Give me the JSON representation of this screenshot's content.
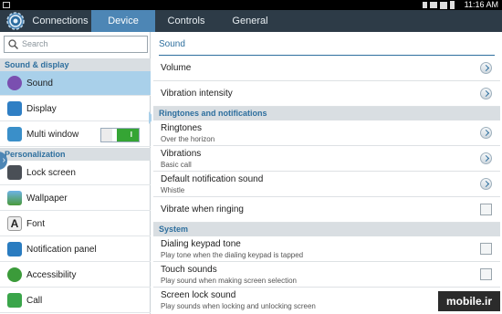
{
  "status_bar": {
    "time": "11:16 AM"
  },
  "tabs": [
    {
      "label": "Connections"
    },
    {
      "label": "Device"
    },
    {
      "label": "Controls"
    },
    {
      "label": "General"
    }
  ],
  "search": {
    "placeholder": "Search"
  },
  "left": {
    "sections": [
      {
        "title": "Sound & display"
      },
      {
        "title": "Personalization"
      }
    ],
    "items": [
      {
        "label": "Sound",
        "icon": "speaker-icon"
      },
      {
        "label": "Display",
        "icon": "display-icon"
      },
      {
        "label": "Multi window",
        "icon": "multi-window-icon",
        "toggle": "I"
      },
      {
        "label": "Lock screen",
        "icon": "lock-screen-icon"
      },
      {
        "label": "Wallpaper",
        "icon": "wallpaper-icon"
      },
      {
        "label": "Font",
        "icon": "font-icon"
      },
      {
        "label": "Notification panel",
        "icon": "notification-panel-icon"
      },
      {
        "label": "Accessibility",
        "icon": "accessibility-icon"
      },
      {
        "label": "Call",
        "icon": "call-icon"
      }
    ]
  },
  "right": {
    "title": "Sound",
    "rows": [
      {
        "title": "Volume"
      },
      {
        "title": "Vibration intensity"
      },
      {
        "title": "Ringtones",
        "sub": "Over the horizon"
      },
      {
        "title": "Vibrations",
        "sub": "Basic call"
      },
      {
        "title": "Default notification sound",
        "sub": "Whistle"
      },
      {
        "title": "Vibrate when ringing"
      },
      {
        "title": "Dialing keypad tone",
        "sub": "Play tone when the dialing keypad is tapped"
      },
      {
        "title": "Touch sounds",
        "sub": "Play sound when making screen selection"
      },
      {
        "title": "Screen lock sound",
        "sub": "Play sounds when locking and unlocking screen"
      }
    ],
    "sections": [
      {
        "title": "Ringtones and notifications"
      },
      {
        "title": "System"
      }
    ]
  },
  "watermark": "mobile.ir",
  "colors": {
    "tab_bar": "#2d3b47",
    "active_tab": "#4d86b5",
    "accent": "#2e6f9e",
    "selected": "#a9d0ea",
    "toggle_on": "#35a534"
  }
}
